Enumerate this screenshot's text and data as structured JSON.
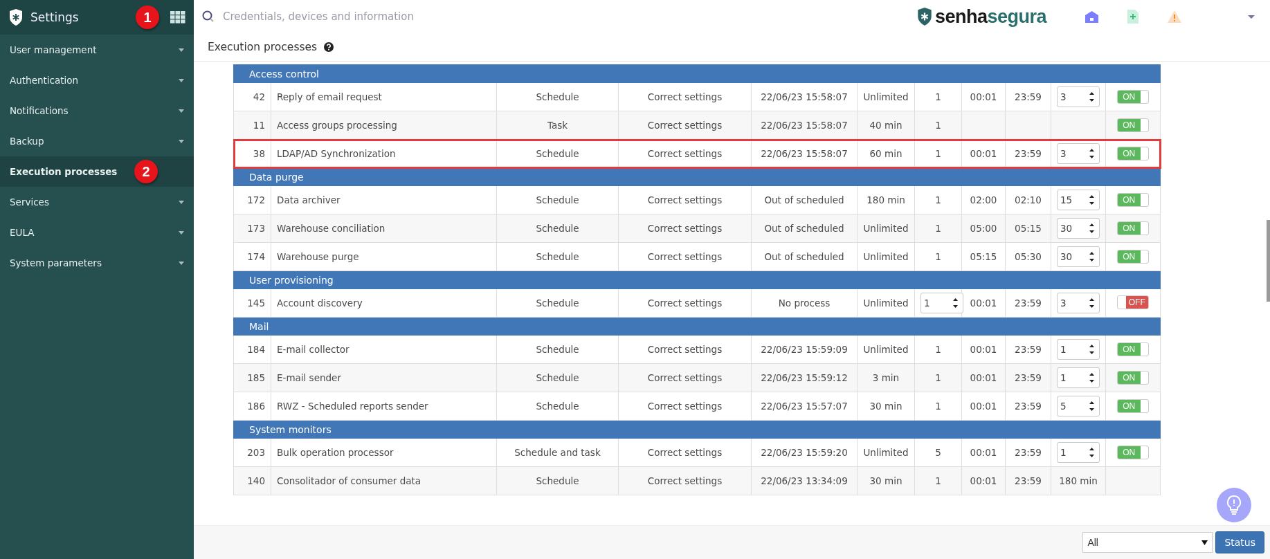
{
  "sidebar": {
    "title": "Settings",
    "callout": "1",
    "items": [
      {
        "label": "User management",
        "has_submenu": true,
        "selected": false
      },
      {
        "label": "Authentication",
        "has_submenu": true,
        "selected": false
      },
      {
        "label": "Notifications",
        "has_submenu": true,
        "selected": false
      },
      {
        "label": "Backup",
        "has_submenu": true,
        "selected": false
      },
      {
        "label": "Execution processes",
        "has_submenu": false,
        "selected": true,
        "callout": "2"
      },
      {
        "label": "Services",
        "has_submenu": true,
        "selected": false
      },
      {
        "label": "EULA",
        "has_submenu": true,
        "selected": false
      },
      {
        "label": "System parameters",
        "has_submenu": true,
        "selected": false
      }
    ]
  },
  "topbar": {
    "search": {
      "placeholder": "Credentials, devices and information"
    },
    "logo": [
      "senha",
      "segura"
    ]
  },
  "page": {
    "title": "Execution processes"
  },
  "table": {
    "groups": [
      {
        "title": "Access control",
        "rows": [
          {
            "id": "42",
            "name": "Reply of email request",
            "type": "Schedule",
            "status": "Correct settings",
            "last_run": "22/06/23 15:58:07",
            "duration": "Unlimited",
            "instances": {
              "kind": "text",
              "value": "1"
            },
            "start": "00:01",
            "end": "23:59",
            "interval": {
              "kind": "spinner",
              "value": "3"
            },
            "switch": {
              "on": true,
              "label": "ON"
            },
            "highlighted": false
          },
          {
            "id": "11",
            "name": "Access groups processing",
            "type": "Task",
            "status": "Correct settings",
            "last_run": "22/06/23 15:58:07",
            "duration": "40 min",
            "instances": {
              "kind": "text",
              "value": "1"
            },
            "switch": {
              "on": true,
              "label": "ON"
            },
            "highlighted": false
          },
          {
            "id": "38",
            "name": "LDAP/AD Synchronization",
            "type": "Schedule",
            "status": "Correct settings",
            "last_run": "22/06/23 15:58:07",
            "duration": "60 min",
            "instances": {
              "kind": "text",
              "value": "1"
            },
            "start": "00:01",
            "end": "23:59",
            "interval": {
              "kind": "spinner",
              "value": "3"
            },
            "switch": {
              "on": true,
              "label": "ON"
            },
            "highlighted": true
          }
        ]
      },
      {
        "title": "Data purge",
        "rows": [
          {
            "id": "172",
            "name": "Data archiver",
            "type": "Schedule",
            "status": "Correct settings",
            "last_run": "Out of scheduled",
            "duration": "180 min",
            "instances": {
              "kind": "text",
              "value": "1"
            },
            "start": "02:00",
            "end": "02:10",
            "interval": {
              "kind": "spinner",
              "value": "15"
            },
            "switch": {
              "on": true,
              "label": "ON"
            },
            "highlighted": false
          },
          {
            "id": "173",
            "name": "Warehouse conciliation",
            "type": "Schedule",
            "status": "Correct settings",
            "last_run": "Out of scheduled",
            "duration": "Unlimited",
            "instances": {
              "kind": "text",
              "value": "1"
            },
            "start": "05:00",
            "end": "05:15",
            "interval": {
              "kind": "spinner",
              "value": "30"
            },
            "switch": {
              "on": true,
              "label": "ON"
            },
            "highlighted": false
          },
          {
            "id": "174",
            "name": "Warehouse purge",
            "type": "Schedule",
            "status": "Correct settings",
            "last_run": "Out of scheduled",
            "duration": "Unlimited",
            "instances": {
              "kind": "text",
              "value": "1"
            },
            "start": "05:15",
            "end": "05:30",
            "interval": {
              "kind": "spinner",
              "value": "30"
            },
            "switch": {
              "on": true,
              "label": "ON"
            },
            "highlighted": false
          }
        ]
      },
      {
        "title": "User provisioning",
        "rows": [
          {
            "id": "145",
            "name": "Account discovery",
            "type": "Schedule",
            "status": "Correct settings",
            "last_run": "No process",
            "duration": "Unlimited",
            "instances": {
              "kind": "spinner",
              "value": "1"
            },
            "start": "00:01",
            "end": "23:59",
            "interval": {
              "kind": "spinner",
              "value": "3"
            },
            "switch": {
              "on": false,
              "label": "OFF"
            },
            "highlighted": false
          }
        ]
      },
      {
        "title": "Mail",
        "rows": [
          {
            "id": "184",
            "name": "E-mail collector",
            "type": "Schedule",
            "status": "Correct settings",
            "last_run": "22/06/23 15:59:09",
            "duration": "Unlimited",
            "instances": {
              "kind": "text",
              "value": "1"
            },
            "start": "00:01",
            "end": "23:59",
            "interval": {
              "kind": "spinner",
              "value": "1"
            },
            "switch": {
              "on": true,
              "label": "ON"
            },
            "highlighted": false
          },
          {
            "id": "185",
            "name": "E-mail sender",
            "type": "Schedule",
            "status": "Correct settings",
            "last_run": "22/06/23 15:59:12",
            "duration": "3 min",
            "instances": {
              "kind": "text",
              "value": "1"
            },
            "start": "00:01",
            "end": "23:59",
            "interval": {
              "kind": "spinner",
              "value": "1"
            },
            "switch": {
              "on": true,
              "label": "ON"
            },
            "highlighted": false
          },
          {
            "id": "186",
            "name": "RWZ - Scheduled reports sender",
            "type": "Schedule",
            "status": "Correct settings",
            "last_run": "22/06/23 15:57:07",
            "duration": "30 min",
            "instances": {
              "kind": "text",
              "value": "1"
            },
            "start": "00:01",
            "end": "23:59",
            "interval": {
              "kind": "spinner",
              "value": "5"
            },
            "switch": {
              "on": true,
              "label": "ON"
            },
            "highlighted": false
          }
        ]
      },
      {
        "title": "System monitors",
        "rows": [
          {
            "id": "203",
            "name": "Bulk operation processor",
            "type": "Schedule and task",
            "status": "Correct settings",
            "last_run": "22/06/23 15:59:20",
            "duration": "Unlimited",
            "instances": {
              "kind": "text",
              "value": "5"
            },
            "start": "00:01",
            "end": "23:59",
            "interval": {
              "kind": "spinner",
              "value": "1"
            },
            "switch": {
              "on": true,
              "label": "ON"
            },
            "highlighted": false
          },
          {
            "id": "140",
            "name": "Consolitador of consumer data",
            "type": "Schedule",
            "status": "Correct settings",
            "last_run": "22/06/23 13:34:09",
            "duration": "30 min",
            "instances": {
              "kind": "text",
              "value": "1"
            },
            "start": "00:01",
            "end": "23:59",
            "interval": {
              "kind": "text",
              "value": "180 min"
            },
            "highlighted": false
          }
        ]
      }
    ]
  },
  "footer": {
    "filter": {
      "value": "All"
    },
    "button": "Status"
  }
}
